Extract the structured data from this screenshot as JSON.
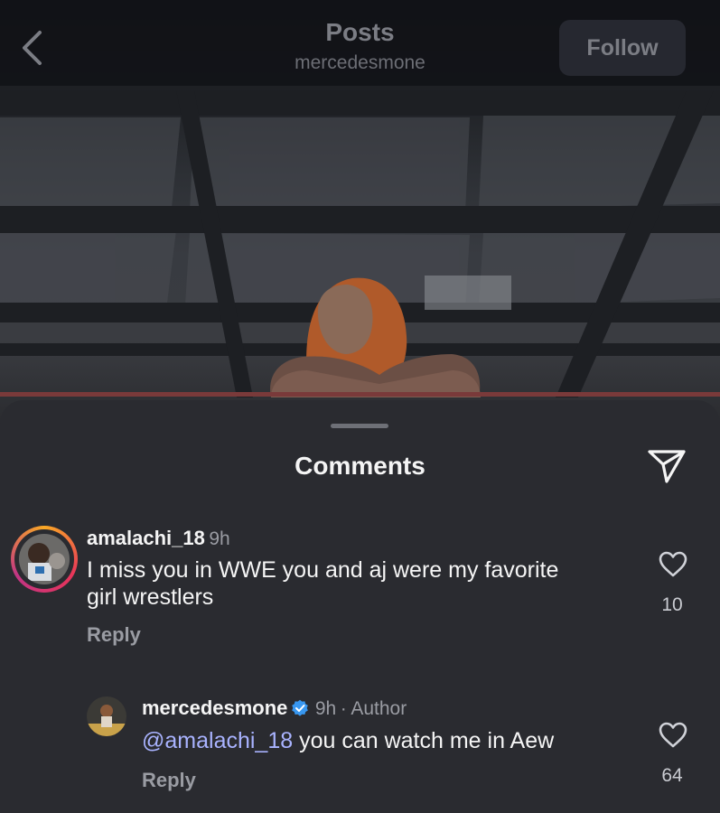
{
  "header": {
    "title": "Posts",
    "subtitle": "mercedesmone",
    "follow_label": "Follow"
  },
  "sheet": {
    "title": "Comments"
  },
  "comments": [
    {
      "username": "amalachi_18",
      "time": "9h",
      "text_line1": "I miss you in WWE you and aj were my favorite",
      "text_line2": "girl wrestlers",
      "reply_label": "Reply",
      "likes": "10"
    },
    {
      "username": "mercedesmone",
      "time": "9h",
      "author_tag": "· Author",
      "mention": "@amalachi_18",
      "text": " you can watch me in Aew",
      "reply_label": "Reply",
      "likes": "64"
    }
  ],
  "colors": {
    "background": "#15161a",
    "sheet": "#2a2b30",
    "mention": "#a9b3ff",
    "verified": "#3897f0"
  },
  "icons": [
    "back-chevron-icon",
    "share-icon",
    "heart-icon",
    "verified-badge-icon"
  ]
}
